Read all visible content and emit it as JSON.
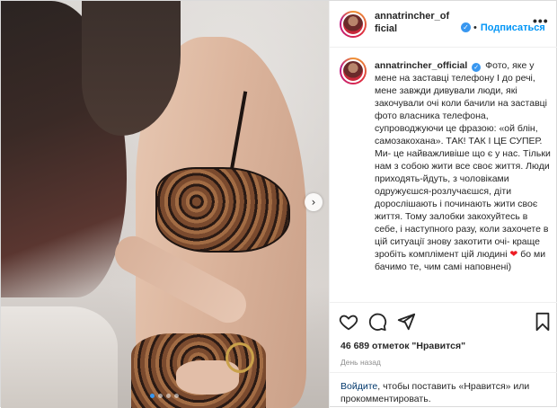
{
  "post": {
    "username_header_line1": "annatrincher_of",
    "username_header_line2": "ficial",
    "separator": "•",
    "follow_label": "Подписаться",
    "more_label": "•••",
    "verified_glyph": "✓"
  },
  "caption": {
    "username": "annatrincher_official",
    "verified_glyph": "✓",
    "text_part1": "Фото, яке у мене на заставці телефону І до речі, мене завжди дивували люди, які закочували очі коли бачили на заставці фото власника телефона, супроводжуючи це фразою: «ой блін, самозакохана». ТАК! ТАК І ЦЕ СУПЕР. Ми- це найважливіше що є у нас. Тільки нам з собою жити все своє життя. Люди приходять-йдуть, з чоловіками одружуєшся-розлучаєшся, діти дорослішають і починають жити своє життя. Тому залобки закохуйтесь в себе, і наступного разу, коли захочете в цій ситуації знову закотити очі- краще зробіть комплімент цій людині",
    "heart_glyph": "❤",
    "text_part2": "бо ми бачимо те, чим самі наповнені)"
  },
  "media": {
    "next_glyph": "›",
    "dots_count": 4,
    "active_dot": 0
  },
  "actions": {
    "like_icon": "heart-outline-icon",
    "comment_icon": "comment-bubble-icon",
    "share_icon": "paper-plane-icon",
    "save_icon": "bookmark-icon"
  },
  "stats": {
    "likes_count": "46 689",
    "likes_word": "отметок",
    "likes_suffix": "\"Нравится\"",
    "date": "День назад"
  },
  "comment": {
    "login_link": "Войдите",
    "text": ", чтобы поставить «Нравится» или прокомментировать."
  },
  "colors": {
    "accent": "#0095f6",
    "verified": "#3897f0",
    "heart": "#ed1c24",
    "muted": "#8e8e8e"
  }
}
